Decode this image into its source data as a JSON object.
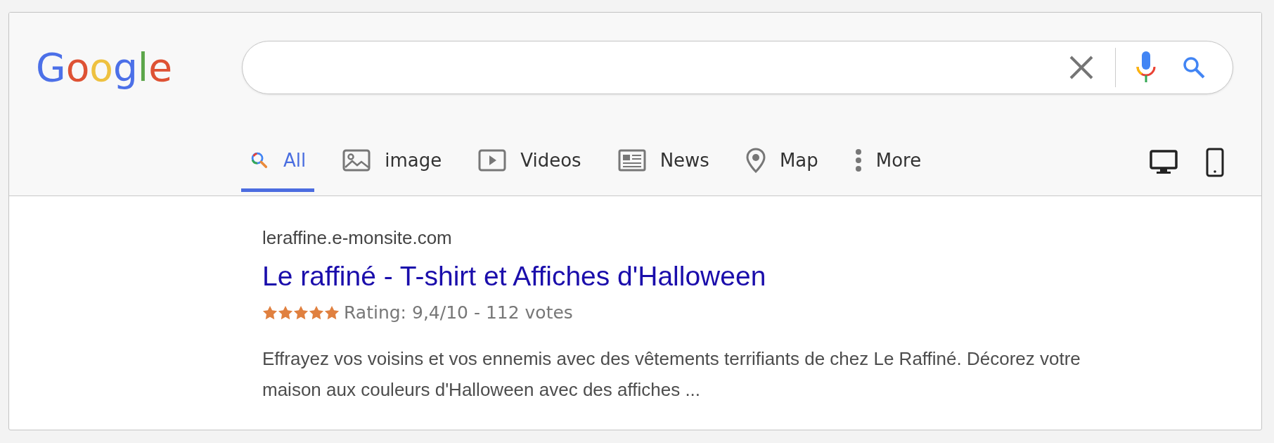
{
  "logo": "Google",
  "tabs": [
    {
      "label": "All",
      "kind": "search",
      "selected": true
    },
    {
      "label": "image",
      "kind": "image",
      "selected": false
    },
    {
      "label": "Videos",
      "kind": "video",
      "selected": false
    },
    {
      "label": "News",
      "kind": "news",
      "selected": false
    },
    {
      "label": "Map",
      "kind": "map",
      "selected": false
    },
    {
      "label": "More",
      "kind": "more",
      "selected": false
    }
  ],
  "result": {
    "url": "leraffine.e-monsite.com",
    "title": "Le raffiné - T-shirt et Affiches d'Halloween",
    "stars": 5,
    "rating": "Rating: 9,4/10 - 112 votes",
    "snippet": "Effrayez vos voisins et vos ennemis avec des vêtements terrifiants de chez Le Raffiné. Décorez votre maison aux couleurs d'Halloween avec des affiches ..."
  }
}
